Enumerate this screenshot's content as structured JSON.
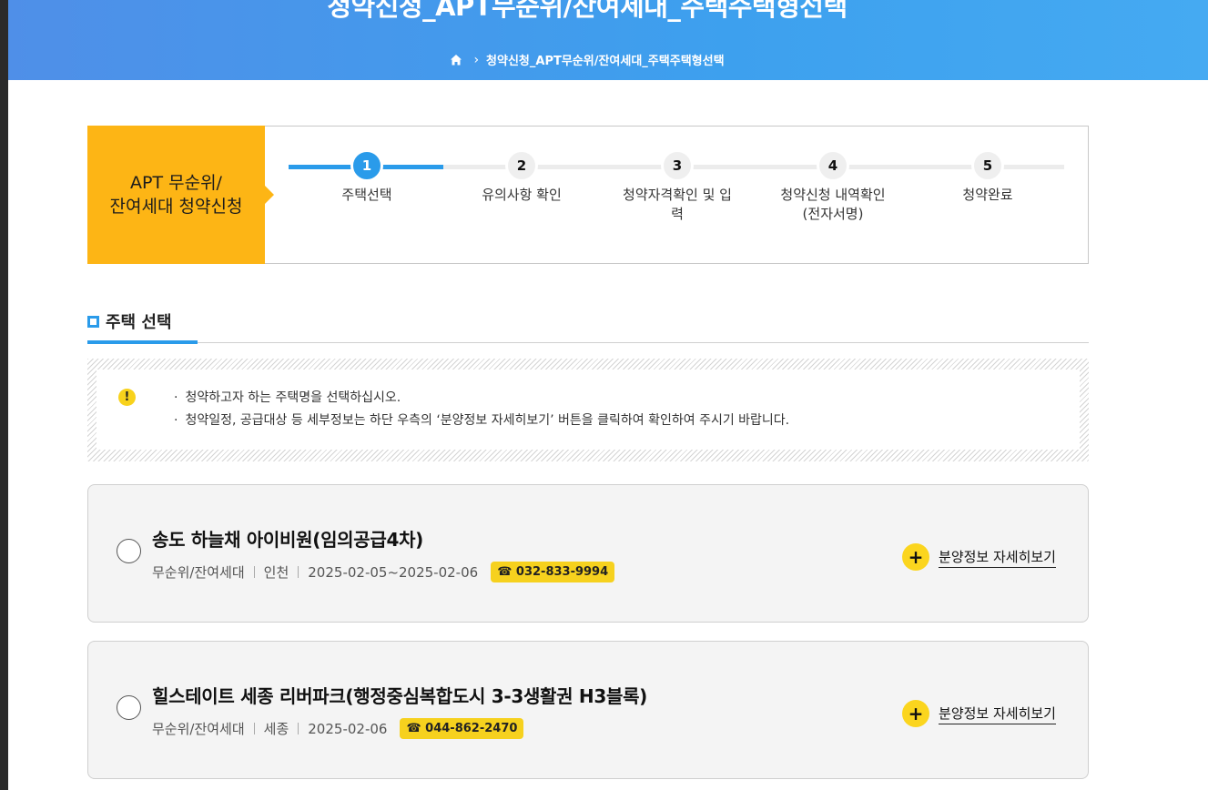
{
  "header": {
    "title": "청약신청_APT무순위/잔여세대_주택주택형선택",
    "breadcrumb": "청약신청_APT무순위/잔여세대_주택주택형선택"
  },
  "stepper": {
    "heading_line1": "APT 무순위/",
    "heading_line2": "잔여세대 청약신청",
    "steps": [
      {
        "num": "1",
        "label": "주택선택"
      },
      {
        "num": "2",
        "label": "유의사항 확인"
      },
      {
        "num": "3",
        "label": "청약자격확인 및 입력"
      },
      {
        "num": "4",
        "label": "청약신청 내역확인 (전자서명)"
      },
      {
        "num": "5",
        "label": "청약완료"
      }
    ],
    "current_step": 1
  },
  "section": {
    "title": "주택 선택"
  },
  "notice": {
    "icon": "!",
    "lines": [
      "청약하고자 하는 주택명을 선택하십시오.",
      "청약일정, 공급대상 등 세부정보는 하단 우측의 ‘분양정보 자세히보기’ 버튼을 클릭하여 확인하여 주시기 바랍니다."
    ]
  },
  "listings": [
    {
      "name": "송도 하늘채 아이비원(임의공급4차)",
      "type": "무순위/잔여세대",
      "region": "인천",
      "period": "2025-02-05~2025-02-06",
      "phone": "☎ 032-833-9994",
      "detail_label": "분양정보 자세히보기"
    },
    {
      "name": "힐스테이트 세종 리버파크(행정중심복합도시 3-3생활권 H3블록)",
      "type": "무순위/잔여세대",
      "region": "세종",
      "period": "2025-02-06",
      "phone": "☎ 044-862-2470",
      "detail_label": "분양정보 자세히보기"
    }
  ],
  "colors": {
    "header_blue": "#3da0ee",
    "accent_blue": "#2a9bea",
    "step_head_yellow": "#fdb515",
    "badge_yellow": "#f6d11e"
  }
}
